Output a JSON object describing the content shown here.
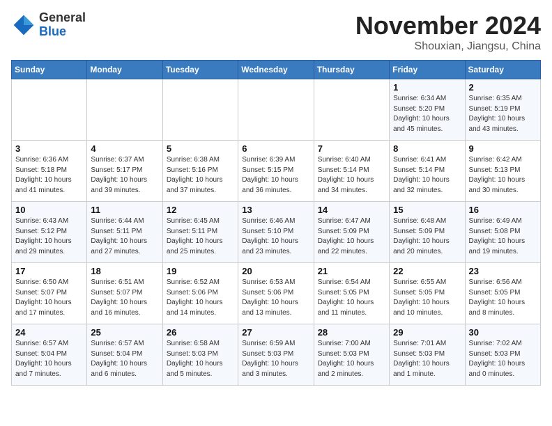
{
  "header": {
    "logo_general": "General",
    "logo_blue": "Blue",
    "month_title": "November 2024",
    "location": "Shouxian, Jiangsu, China"
  },
  "days_of_week": [
    "Sunday",
    "Monday",
    "Tuesday",
    "Wednesday",
    "Thursday",
    "Friday",
    "Saturday"
  ],
  "weeks": [
    [
      {
        "day": "",
        "info": ""
      },
      {
        "day": "",
        "info": ""
      },
      {
        "day": "",
        "info": ""
      },
      {
        "day": "",
        "info": ""
      },
      {
        "day": "",
        "info": ""
      },
      {
        "day": "1",
        "info": "Sunrise: 6:34 AM\nSunset: 5:20 PM\nDaylight: 10 hours\nand 45 minutes."
      },
      {
        "day": "2",
        "info": "Sunrise: 6:35 AM\nSunset: 5:19 PM\nDaylight: 10 hours\nand 43 minutes."
      }
    ],
    [
      {
        "day": "3",
        "info": "Sunrise: 6:36 AM\nSunset: 5:18 PM\nDaylight: 10 hours\nand 41 minutes."
      },
      {
        "day": "4",
        "info": "Sunrise: 6:37 AM\nSunset: 5:17 PM\nDaylight: 10 hours\nand 39 minutes."
      },
      {
        "day": "5",
        "info": "Sunrise: 6:38 AM\nSunset: 5:16 PM\nDaylight: 10 hours\nand 37 minutes."
      },
      {
        "day": "6",
        "info": "Sunrise: 6:39 AM\nSunset: 5:15 PM\nDaylight: 10 hours\nand 36 minutes."
      },
      {
        "day": "7",
        "info": "Sunrise: 6:40 AM\nSunset: 5:14 PM\nDaylight: 10 hours\nand 34 minutes."
      },
      {
        "day": "8",
        "info": "Sunrise: 6:41 AM\nSunset: 5:14 PM\nDaylight: 10 hours\nand 32 minutes."
      },
      {
        "day": "9",
        "info": "Sunrise: 6:42 AM\nSunset: 5:13 PM\nDaylight: 10 hours\nand 30 minutes."
      }
    ],
    [
      {
        "day": "10",
        "info": "Sunrise: 6:43 AM\nSunset: 5:12 PM\nDaylight: 10 hours\nand 29 minutes."
      },
      {
        "day": "11",
        "info": "Sunrise: 6:44 AM\nSunset: 5:11 PM\nDaylight: 10 hours\nand 27 minutes."
      },
      {
        "day": "12",
        "info": "Sunrise: 6:45 AM\nSunset: 5:11 PM\nDaylight: 10 hours\nand 25 minutes."
      },
      {
        "day": "13",
        "info": "Sunrise: 6:46 AM\nSunset: 5:10 PM\nDaylight: 10 hours\nand 23 minutes."
      },
      {
        "day": "14",
        "info": "Sunrise: 6:47 AM\nSunset: 5:09 PM\nDaylight: 10 hours\nand 22 minutes."
      },
      {
        "day": "15",
        "info": "Sunrise: 6:48 AM\nSunset: 5:09 PM\nDaylight: 10 hours\nand 20 minutes."
      },
      {
        "day": "16",
        "info": "Sunrise: 6:49 AM\nSunset: 5:08 PM\nDaylight: 10 hours\nand 19 minutes."
      }
    ],
    [
      {
        "day": "17",
        "info": "Sunrise: 6:50 AM\nSunset: 5:07 PM\nDaylight: 10 hours\nand 17 minutes."
      },
      {
        "day": "18",
        "info": "Sunrise: 6:51 AM\nSunset: 5:07 PM\nDaylight: 10 hours\nand 16 minutes."
      },
      {
        "day": "19",
        "info": "Sunrise: 6:52 AM\nSunset: 5:06 PM\nDaylight: 10 hours\nand 14 minutes."
      },
      {
        "day": "20",
        "info": "Sunrise: 6:53 AM\nSunset: 5:06 PM\nDaylight: 10 hours\nand 13 minutes."
      },
      {
        "day": "21",
        "info": "Sunrise: 6:54 AM\nSunset: 5:05 PM\nDaylight: 10 hours\nand 11 minutes."
      },
      {
        "day": "22",
        "info": "Sunrise: 6:55 AM\nSunset: 5:05 PM\nDaylight: 10 hours\nand 10 minutes."
      },
      {
        "day": "23",
        "info": "Sunrise: 6:56 AM\nSunset: 5:05 PM\nDaylight: 10 hours\nand 8 minutes."
      }
    ],
    [
      {
        "day": "24",
        "info": "Sunrise: 6:57 AM\nSunset: 5:04 PM\nDaylight: 10 hours\nand 7 minutes."
      },
      {
        "day": "25",
        "info": "Sunrise: 6:57 AM\nSunset: 5:04 PM\nDaylight: 10 hours\nand 6 minutes."
      },
      {
        "day": "26",
        "info": "Sunrise: 6:58 AM\nSunset: 5:03 PM\nDaylight: 10 hours\nand 5 minutes."
      },
      {
        "day": "27",
        "info": "Sunrise: 6:59 AM\nSunset: 5:03 PM\nDaylight: 10 hours\nand 3 minutes."
      },
      {
        "day": "28",
        "info": "Sunrise: 7:00 AM\nSunset: 5:03 PM\nDaylight: 10 hours\nand 2 minutes."
      },
      {
        "day": "29",
        "info": "Sunrise: 7:01 AM\nSunset: 5:03 PM\nDaylight: 10 hours\nand 1 minute."
      },
      {
        "day": "30",
        "info": "Sunrise: 7:02 AM\nSunset: 5:03 PM\nDaylight: 10 hours\nand 0 minutes."
      }
    ]
  ]
}
